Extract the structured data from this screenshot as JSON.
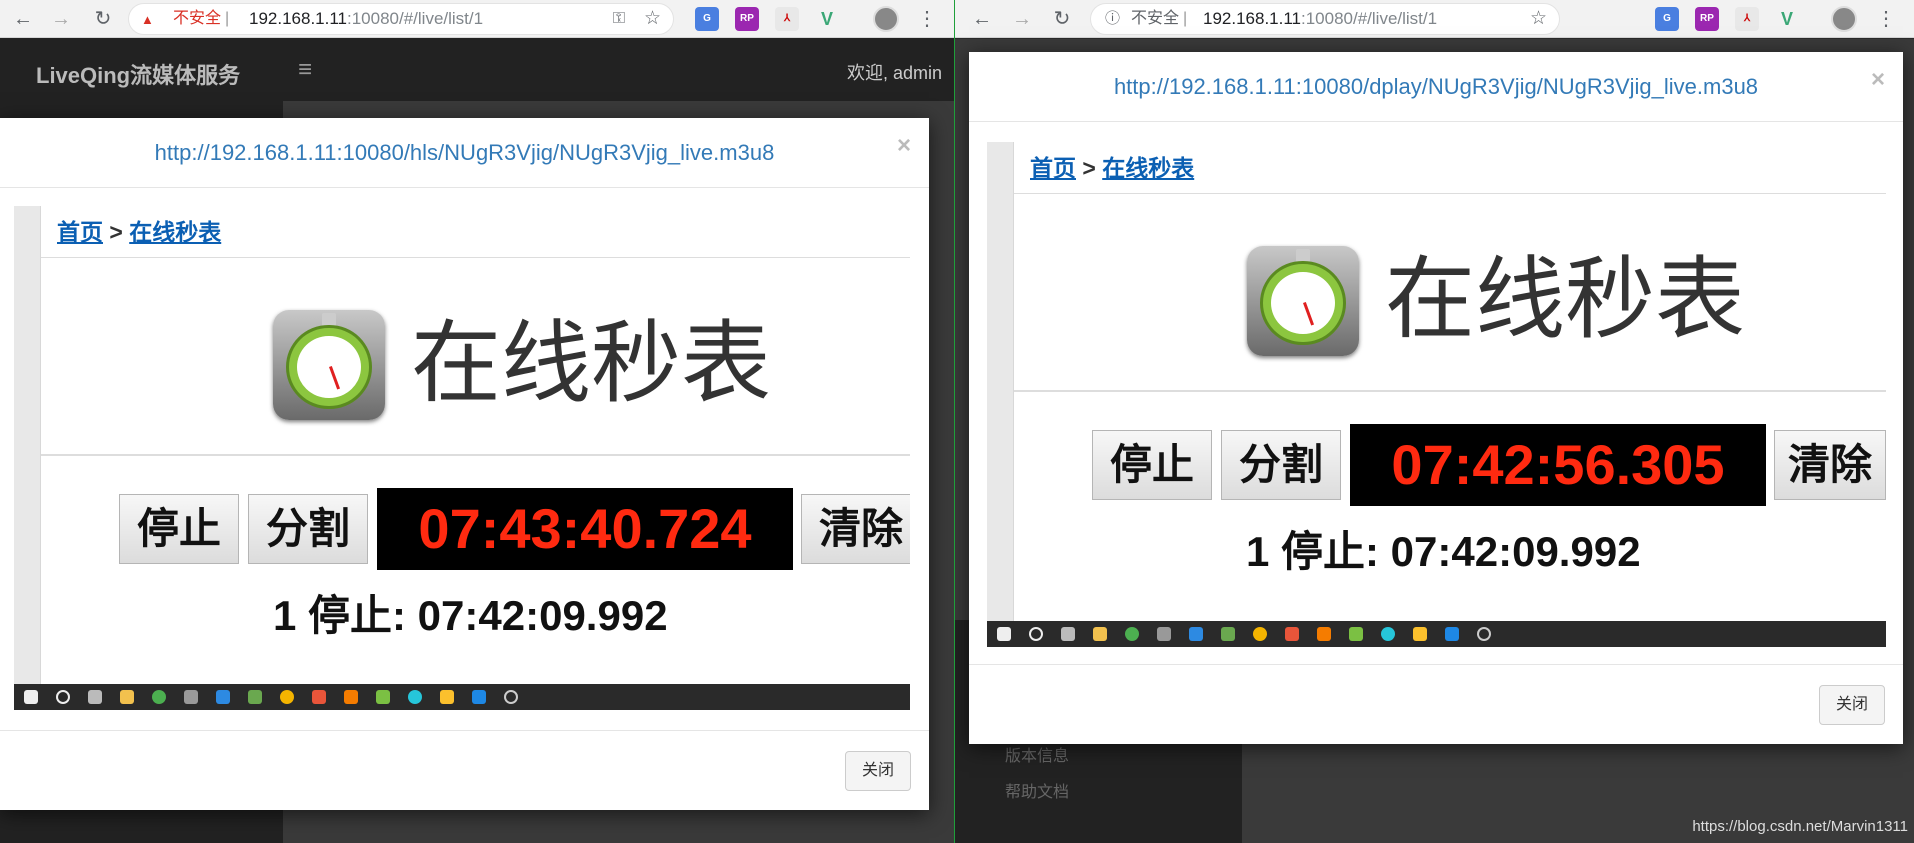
{
  "left": {
    "browser": {
      "security_label": "不安全",
      "url_host": "192.168.1.11",
      "url_rest": ":10080/#/live/list/1"
    },
    "app": {
      "brand": "LiveQing流媒体服务",
      "welcome": "欢迎, admin"
    },
    "modal": {
      "title": "http://192.168.1.11:10080/hls/NUgR3Vjig/NUgR3Vjig_live.m3u8",
      "close_symbol": "×",
      "close_button": "关闭"
    },
    "stopwatch": {
      "crumb_home": "首页",
      "crumb_sep": ">",
      "crumb_current": "在线秒表",
      "title": "在线秒表",
      "stop": "停止",
      "split": "分割",
      "time": "07:43:40.724",
      "clear": "清除",
      "lap": "1 停止: 07:42:09.992"
    }
  },
  "right": {
    "browser": {
      "security_label": "不安全",
      "url_host": "192.168.1.11",
      "url_rest": ":10080/#/live/list/1"
    },
    "modal": {
      "title": "http://192.168.1.11:10080/dplay/NUgR3Vjig/NUgR3Vjig_live.m3u8",
      "close_symbol": "×",
      "close_button": "关闭"
    },
    "stopwatch": {
      "crumb_home": "首页",
      "crumb_sep": ">",
      "crumb_current": "在线秒表",
      "title": "在线秒表",
      "stop": "停止",
      "split": "分割",
      "time": "07:42:56.305",
      "clear": "清除",
      "lap": "1 停止: 07:42:09.992"
    },
    "bg_menu": [
      "版本信息",
      "帮助文档"
    ]
  },
  "watermark": "https://blog.csdn.net/Marvin1311",
  "colors": {
    "timer_text": "#ff2a10",
    "timer_bg": "#000000",
    "link": "#337ab7",
    "divider": "#1f9f3a"
  }
}
